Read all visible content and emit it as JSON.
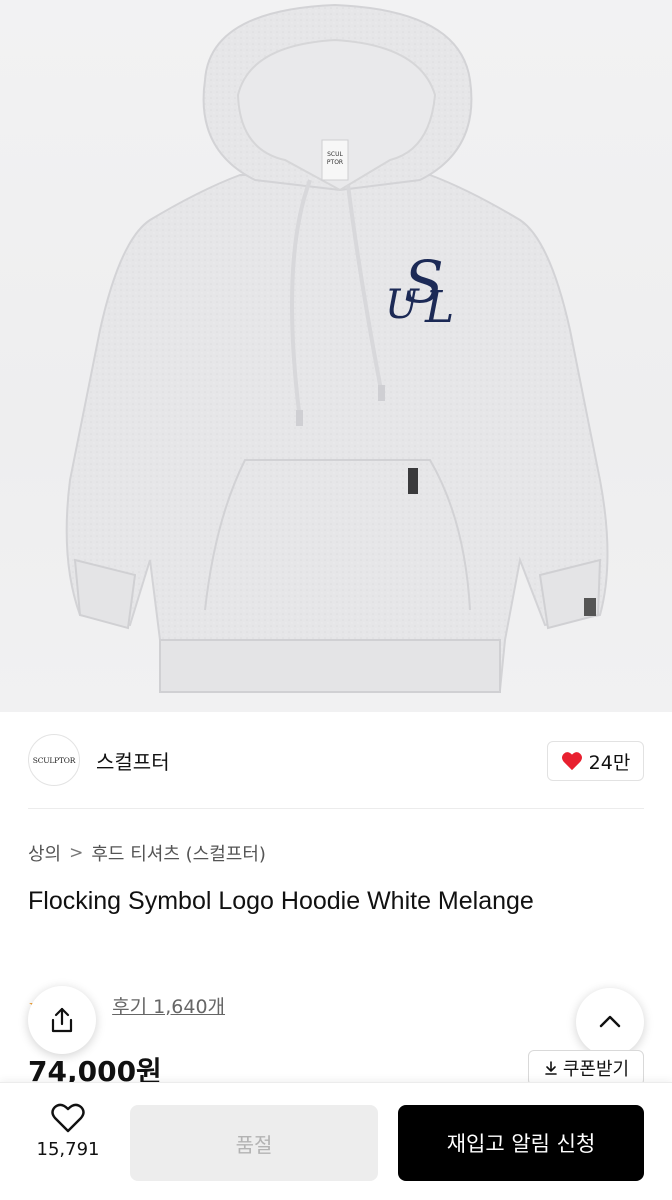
{
  "product_image": {
    "alt": "Flocking Symbol Logo Hoodie White Melange",
    "chest_logo": "SUL",
    "neck_label": "SCULPTOR"
  },
  "brand": {
    "logo_text": "SCULPTOR",
    "name": "스컬프터"
  },
  "like": {
    "count": "24만",
    "heart_color": "#e8202f"
  },
  "breadcrumb": {
    "category": "상의",
    "separator": ">",
    "subcategory": "후드 티셔츠 (스컬프터)"
  },
  "product": {
    "title": "Flocking Symbol Logo Hoodie White Melange",
    "reviews_label": "후기 1,640개",
    "price": "74,000원"
  },
  "coupon": {
    "label": "쿠폰받기"
  },
  "bottom_bar": {
    "wish_count": "15,791",
    "soldout_label": "품절",
    "restock_label": "재입고 알림 신청"
  },
  "colors": {
    "accent_black": "#000000",
    "heart_red": "#e8202f",
    "star_orange": "#f2a33a",
    "logo_navy": "#1c2a56"
  }
}
